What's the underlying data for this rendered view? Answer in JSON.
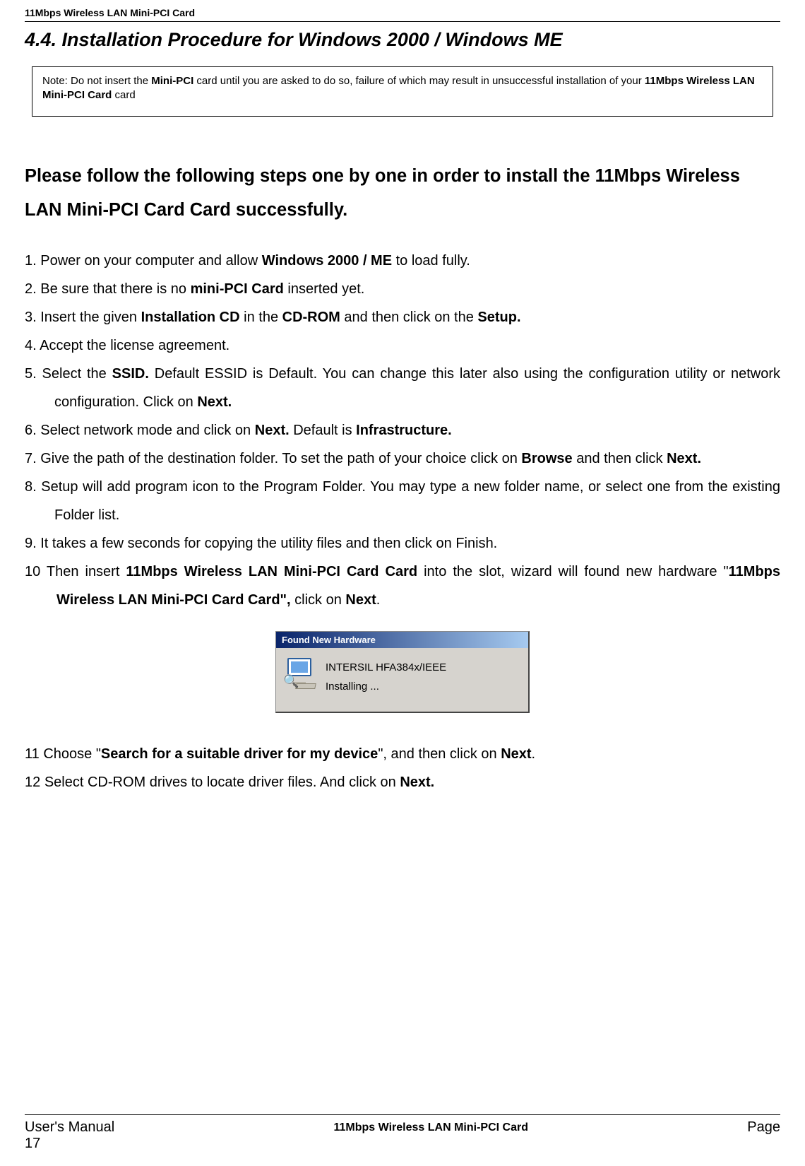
{
  "header": {
    "product": "11Mbps Wireless LAN Mini-PCI Card"
  },
  "title": "4.4. Installation Procedure for Windows 2000 / Windows ME",
  "note": {
    "prefix": "Note: Do not insert the ",
    "b1": "Mini-PCI",
    "mid": " card until you are asked to do so, failure of which may result in unsuccessful installation of your ",
    "b2": "11Mbps Wireless LAN Mini-PCI Card",
    "suffix": " card"
  },
  "lead": "Please follow the following steps one by one in order to install the 11Mbps Wireless LAN Mini-PCI Card Card successfully.",
  "steps": {
    "s1a": "Power on your computer and allow ",
    "s1b": "Windows 2000 / ME",
    "s1c": " to load fully.",
    "s2a": "Be sure that there is no ",
    "s2b": "mini-PCI Card",
    "s2c": " inserted yet.",
    "s3a": "Insert the given ",
    "s3b": "Installation CD",
    "s3c": " in the ",
    "s3d": "CD-ROM",
    "s3e": " and then click on the ",
    "s3f": "Setup.",
    "s4": "Accept the license agreement.",
    "s5a": "Select the ",
    "s5b": "SSID.",
    "s5c": "  Default ESSID is Default.  You can change this later also using the configuration utility or network configuration.  Click on ",
    "s5d": "Next.",
    "s6a": "Select network mode and click on ",
    "s6b": "Next.",
    "s6c": "  Default is ",
    "s6d": "Infrastructure.",
    "s7a": "Give the path of the destination folder.  To set the path of your choice click on ",
    "s7b": "Browse",
    "s7c": " and then click ",
    "s7d": "Next.",
    "s8": "Setup will add program icon to the Program Folder. You may type a new folder name, or select one from the existing Folder list.",
    "s9": "It takes a few seconds for copying the utility files and then click on Finish.",
    "s10a": "Then insert ",
    "s10b": "11Mbps Wireless LAN Mini-PCI Card Card",
    "s10c": " into the slot, wizard will found new hardware \"",
    "s10d": "11Mbps Wireless LAN Mini-PCI Card Card\",",
    "s10e": " click on ",
    "s10f": "Next",
    "s10g": ".",
    "s11a": "Choose \"",
    "s11b": "Search for a suitable driver for my device",
    "s11c": "\", and then click on ",
    "s11d": "Next",
    "s11e": ".",
    "s12a": "Select CD-ROM drives to locate driver files. And click on ",
    "s12b": "Next."
  },
  "dialog": {
    "title": "Found New Hardware",
    "device": "INTERSIL HFA384x/IEEE",
    "status": "Installing ..."
  },
  "footer": {
    "left": "User's Manual",
    "center": "11Mbps Wireless LAN Mini-PCI Card",
    "right": "Page",
    "page": "17"
  }
}
